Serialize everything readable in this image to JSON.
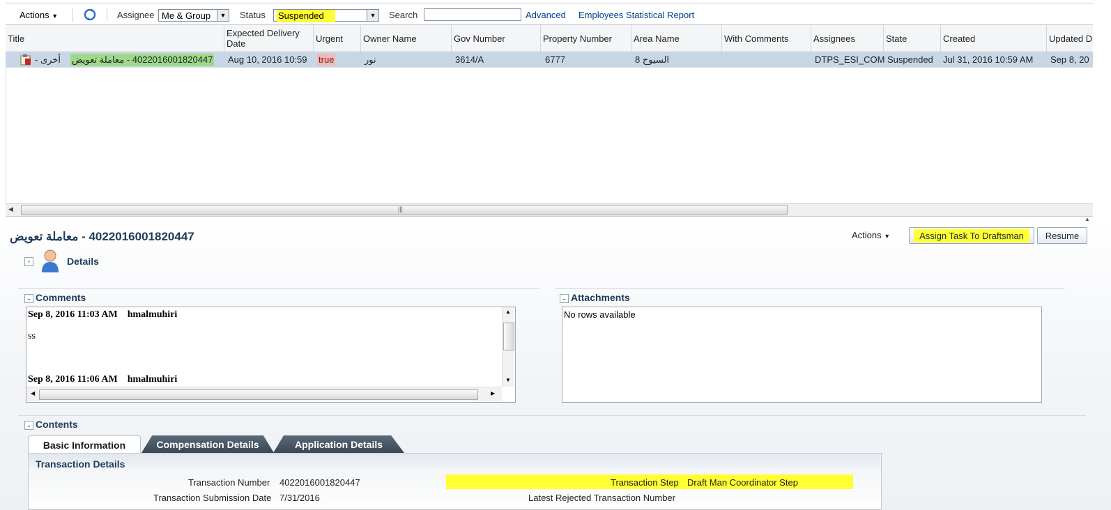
{
  "toolbar": {
    "actions_label": "Actions",
    "assignee_label": "Assignee",
    "assignee_value": "Me & Group",
    "status_label": "Status",
    "status_value": "Suspended",
    "search_label": "Search",
    "search_value": "",
    "advanced_link": "Advanced",
    "report_link": "Employees Statistical Report"
  },
  "table": {
    "columns": [
      "Title",
      "Expected Delivery Date",
      "Urgent",
      "Owner Name",
      "Gov Number",
      "Property Number",
      "Area Name",
      "With Comments",
      "Assignees",
      "State",
      "Created",
      "Updated D"
    ],
    "row": {
      "title_prefix": "أخرى  - ",
      "title_highlight": "4022016001820447 - معاملة تعويض",
      "expected_delivery": "Aug 10, 2016 10:59",
      "urgent": "true",
      "owner_name": "نور",
      "gov_number": "3614/A",
      "property_number": "6777",
      "area_name": "السيوح 8",
      "with_comments": "",
      "assignees": "DTPS_ESI_COM",
      "state": "Suspended",
      "created": "Jul 31, 2016 10:59 AM",
      "updated": "Sep 8, 20"
    }
  },
  "detail": {
    "title": "4022016001820447 - معاملة تعويض",
    "actions_label": "Actions",
    "assign_button": "Assign Task To Draftsman",
    "resume_button": "Resume",
    "details_label": "Details",
    "comments_label": "Comments",
    "comments": [
      {
        "date": "Sep 8, 2016 11:03 AM",
        "user": "hmalmuhiri",
        "text": "ss"
      },
      {
        "date": "Sep 8, 2016 11:06 AM",
        "user": "hmalmuhiri",
        "text": ""
      }
    ],
    "attachments_label": "Attachments",
    "attachments_empty": "No rows available",
    "contents_label": "Contents",
    "tabs": [
      "Basic Information",
      "Compensation Details",
      "Application Details"
    ],
    "transaction_details_label": "Transaction Details",
    "fields": {
      "transaction_number_label": "Transaction Number",
      "transaction_number_value": "4022016001820447",
      "submission_date_label": "Transaction Submission Date",
      "submission_date_value": "7/31/2016",
      "transaction_step_label": "Transaction Step",
      "transaction_step_value": "Draft Man Coordinator Step",
      "latest_rejected_label": "Latest Rejected Transaction Number"
    }
  },
  "colors": {
    "highlight_yellow": "#ffff33",
    "title_green": "#9fd98a",
    "urgent_pink": "#f2b8b8",
    "row_selected": "#c8d7e6",
    "link_blue": "#003d8f",
    "header_navy": "#1f3b5a"
  }
}
